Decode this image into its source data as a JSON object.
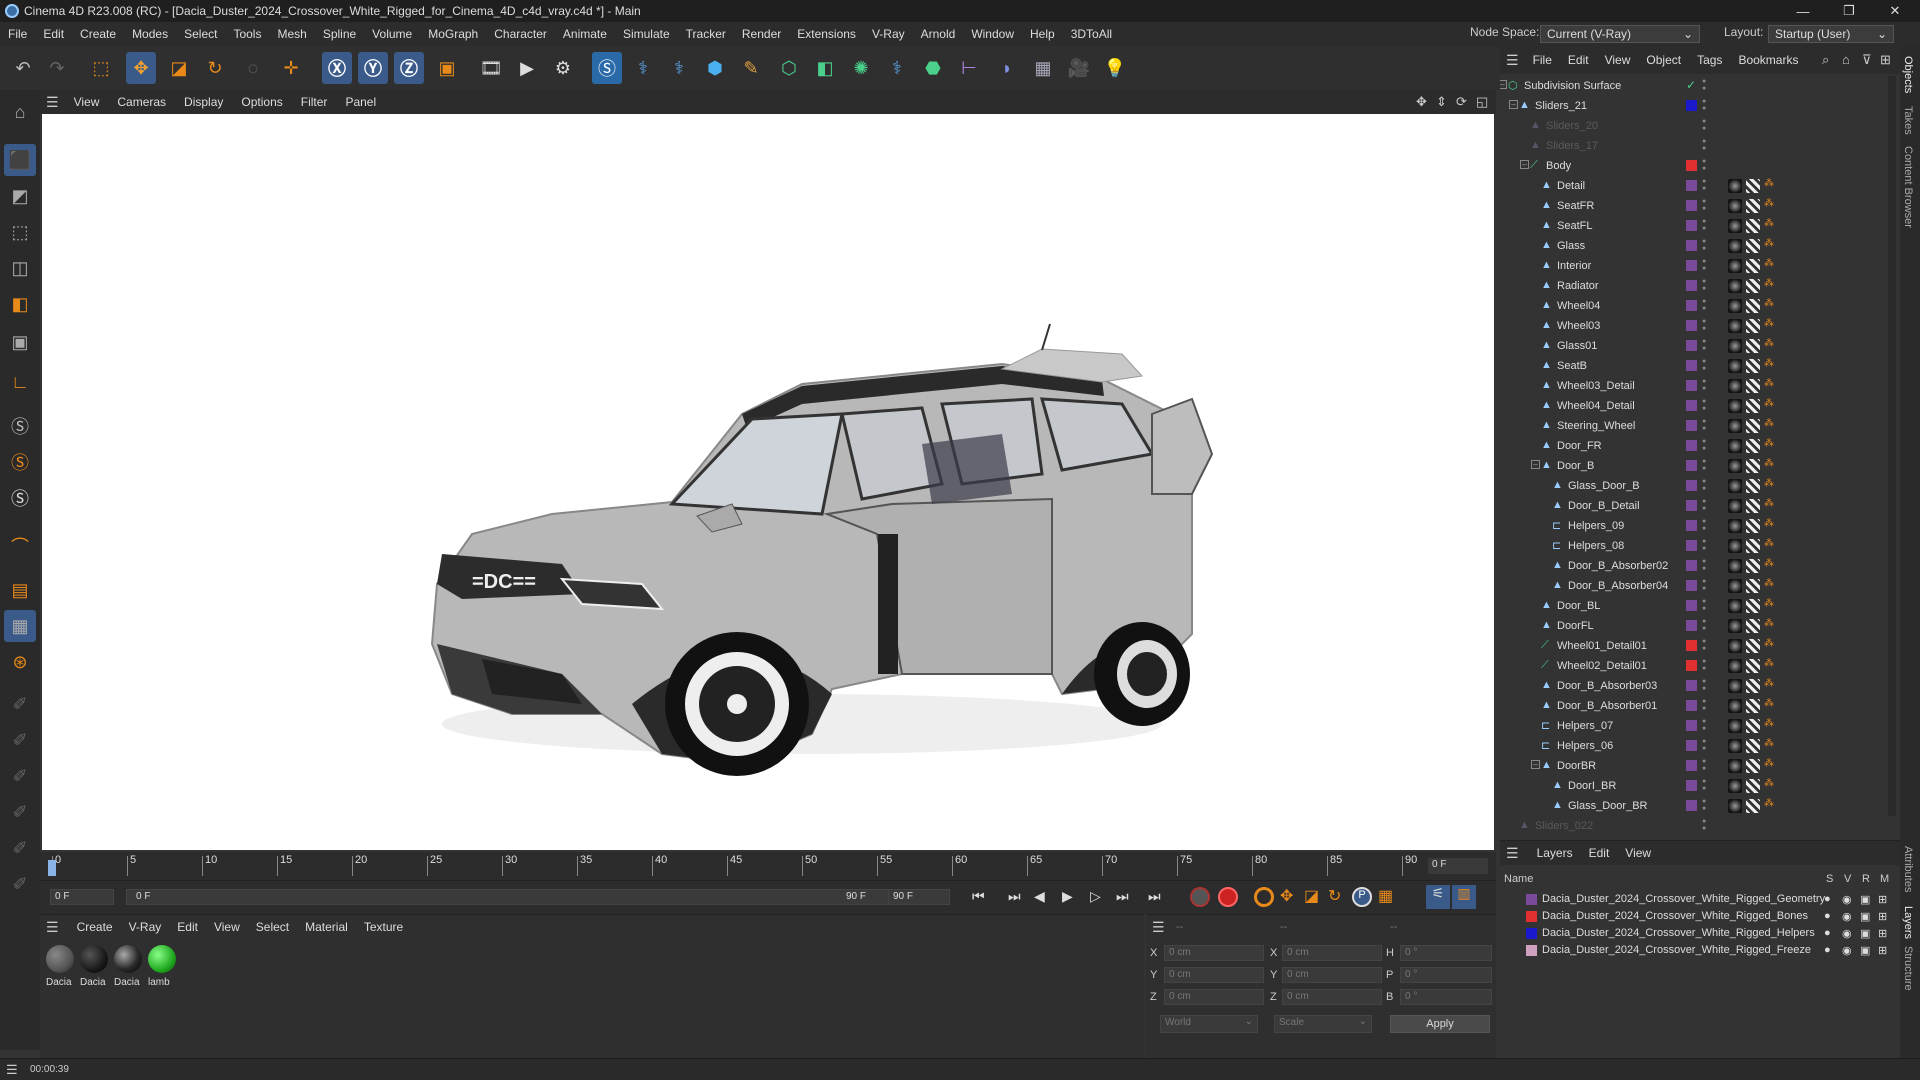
{
  "titlebar": {
    "title": "Cinema 4D R23.008 (RC) - [Dacia_Duster_2024_Crossover_White_Rigged_for_Cinema_4D_c4d_vray.c4d *] - Main",
    "minimize": "—",
    "restore": "❐",
    "close": "✕"
  },
  "menubar": {
    "items": [
      "File",
      "Edit",
      "Create",
      "Modes",
      "Select",
      "Tools",
      "Mesh",
      "Spline",
      "Volume",
      "MoGraph",
      "Character",
      "Animate",
      "Simulate",
      "Tracker",
      "Render",
      "Extensions",
      "V-Ray",
      "Arnold",
      "Window",
      "Help",
      "3DToAll"
    ],
    "node_space_label": "Node Space:",
    "node_space_value": "Current (V-Ray)",
    "layout_label": "Layout:",
    "layout_value": "Startup (User)"
  },
  "viewport_menu": {
    "items": [
      "View",
      "Cameras",
      "Display",
      "Options",
      "Filter",
      "Panel"
    ]
  },
  "object_panel": {
    "menu": [
      "File",
      "Edit",
      "View",
      "Object",
      "Tags",
      "Bookmarks"
    ],
    "rows": [
      {
        "name": "Subdivision Surface",
        "depth": 0,
        "icon": "subdivision-icon",
        "layer": "",
        "dim": false
      },
      {
        "name": "Sliders_21",
        "depth": 1,
        "icon": "null-icon",
        "layer": "#1a1acc",
        "dim": false
      },
      {
        "name": "Sliders_20",
        "depth": 2,
        "icon": "null-icon",
        "layer": "",
        "dim": true
      },
      {
        "name": "Sliders_17",
        "depth": 2,
        "icon": "null-icon",
        "layer": "",
        "dim": true
      },
      {
        "name": "Body",
        "depth": 2,
        "icon": "bone-icon",
        "layer": "#e03030",
        "dim": false
      },
      {
        "name": "Detail",
        "depth": 3,
        "icon": "polygon-icon",
        "layer": "#7a4a9a",
        "dim": false
      },
      {
        "name": "SeatFR",
        "depth": 3,
        "icon": "polygon-icon",
        "layer": "#7a4a9a",
        "dim": false
      },
      {
        "name": "SeatFL",
        "depth": 3,
        "icon": "polygon-icon",
        "layer": "#7a4a9a",
        "dim": false
      },
      {
        "name": "Glass",
        "depth": 3,
        "icon": "polygon-icon",
        "layer": "#7a4a9a",
        "dim": false
      },
      {
        "name": "Interior",
        "depth": 3,
        "icon": "polygon-icon",
        "layer": "#7a4a9a",
        "dim": false
      },
      {
        "name": "Radiator",
        "depth": 3,
        "icon": "polygon-icon",
        "layer": "#7a4a9a",
        "dim": false
      },
      {
        "name": "Wheel04",
        "depth": 3,
        "icon": "polygon-icon",
        "layer": "#7a4a9a",
        "dim": false
      },
      {
        "name": "Wheel03",
        "depth": 3,
        "icon": "polygon-icon",
        "layer": "#7a4a9a",
        "dim": false
      },
      {
        "name": "Glass01",
        "depth": 3,
        "icon": "polygon-icon",
        "layer": "#7a4a9a",
        "dim": false
      },
      {
        "name": "SeatB",
        "depth": 3,
        "icon": "polygon-icon",
        "layer": "#7a4a9a",
        "dim": false
      },
      {
        "name": "Wheel03_Detail",
        "depth": 3,
        "icon": "polygon-icon",
        "layer": "#7a4a9a",
        "dim": false
      },
      {
        "name": "Wheel04_Detail",
        "depth": 3,
        "icon": "polygon-icon",
        "layer": "#7a4a9a",
        "dim": false
      },
      {
        "name": "Steering_Wheel",
        "depth": 3,
        "icon": "polygon-icon",
        "layer": "#7a4a9a",
        "dim": false
      },
      {
        "name": "Door_FR",
        "depth": 3,
        "icon": "polygon-icon",
        "layer": "#7a4a9a",
        "dim": false
      },
      {
        "name": "Door_B",
        "depth": 3,
        "icon": "polygon-icon",
        "layer": "#7a4a9a",
        "dim": false
      },
      {
        "name": "Glass_Door_B",
        "depth": 4,
        "icon": "polygon-icon",
        "layer": "#7a4a9a",
        "dim": false
      },
      {
        "name": "Door_B_Detail",
        "depth": 4,
        "icon": "polygon-icon",
        "layer": "#7a4a9a",
        "dim": false
      },
      {
        "name": "Helpers_09",
        "depth": 4,
        "icon": "helper-icon",
        "layer": "#7a4a9a",
        "dim": false
      },
      {
        "name": "Helpers_08",
        "depth": 4,
        "icon": "helper-icon",
        "layer": "#7a4a9a",
        "dim": false
      },
      {
        "name": "Door_B_Absorber02",
        "depth": 4,
        "icon": "polygon-icon",
        "layer": "#7a4a9a",
        "dim": false
      },
      {
        "name": "Door_B_Absorber04",
        "depth": 4,
        "icon": "polygon-icon",
        "layer": "#7a4a9a",
        "dim": false
      },
      {
        "name": "Door_BL",
        "depth": 3,
        "icon": "polygon-icon",
        "layer": "#7a4a9a",
        "dim": false
      },
      {
        "name": "DoorFL",
        "depth": 3,
        "icon": "polygon-icon",
        "layer": "#7a4a9a",
        "dim": false
      },
      {
        "name": "Wheel01_Detail01",
        "depth": 3,
        "icon": "bone-icon",
        "layer": "#e03030",
        "dim": false
      },
      {
        "name": "Wheel02_Detail01",
        "depth": 3,
        "icon": "bone-icon",
        "layer": "#e03030",
        "dim": false
      },
      {
        "name": "Door_B_Absorber03",
        "depth": 3,
        "icon": "polygon-icon",
        "layer": "#7a4a9a",
        "dim": false
      },
      {
        "name": "Door_B_Absorber01",
        "depth": 3,
        "icon": "polygon-icon",
        "layer": "#7a4a9a",
        "dim": false
      },
      {
        "name": "Helpers_07",
        "depth": 3,
        "icon": "helper-icon",
        "layer": "#7a4a9a",
        "dim": false
      },
      {
        "name": "Helpers_06",
        "depth": 3,
        "icon": "helper-icon",
        "layer": "#7a4a9a",
        "dim": false
      },
      {
        "name": "DoorBR",
        "depth": 3,
        "icon": "polygon-icon",
        "layer": "#7a4a9a",
        "dim": false
      },
      {
        "name": "DoorI_BR",
        "depth": 4,
        "icon": "polygon-icon",
        "layer": "#7a4a9a",
        "dim": false
      },
      {
        "name": "Glass_Door_BR",
        "depth": 4,
        "icon": "polygon-icon",
        "layer": "#7a4a9a",
        "dim": false
      },
      {
        "name": "Sliders_022",
        "depth": 1,
        "icon": "null-icon",
        "layer": "",
        "dim": true
      }
    ]
  },
  "side_tabs": [
    "Objects",
    "Takes",
    "Content Browser",
    "Attributes",
    "Layers",
    "Structure"
  ],
  "timeline": {
    "ticks": [
      "0",
      "5",
      "10",
      "15",
      "20",
      "25",
      "30",
      "35",
      "40",
      "45",
      "50",
      "55",
      "60",
      "65",
      "70",
      "75",
      "80",
      "85",
      "90"
    ],
    "frame_field": "0 F",
    "start_field": "0 F",
    "range_start": "0 F",
    "range_end": "90 F",
    "end_field": "90 F"
  },
  "material_panel": {
    "menu": [
      "Create",
      "V-Ray",
      "Edit",
      "View",
      "Select",
      "Material",
      "Texture"
    ],
    "materials": [
      {
        "label": "Dacia",
        "color": "#555"
      },
      {
        "label": "Dacia",
        "color": "#1a1a1a"
      },
      {
        "label": "Dacia",
        "color": "#2a2a2a"
      },
      {
        "label": "lamb",
        "color": "#22aa22"
      }
    ]
  },
  "coord_panel": {
    "headers": [
      "--",
      "--",
      "--"
    ],
    "rows": [
      {
        "a": "X",
        "av": "0 cm",
        "b": "X",
        "bv": "0 cm",
        "c": "H",
        "cv": "0 °"
      },
      {
        "a": "Y",
        "av": "0 cm",
        "b": "Y",
        "bv": "0 cm",
        "c": "P",
        "cv": "0 °"
      },
      {
        "a": "Z",
        "av": "0 cm",
        "b": "Z",
        "bv": "0 cm",
        "c": "B",
        "cv": "0 °"
      }
    ],
    "world": "World",
    "scale": "Scale",
    "apply": "Apply"
  },
  "layer_panel": {
    "menu": [
      "Layers",
      "Edit",
      "View"
    ],
    "name_header": "Name",
    "cols": [
      "S",
      "V",
      "R",
      "M"
    ],
    "layers": [
      {
        "name": "Dacia_Duster_2024_Crossover_White_Rigged_Geometry",
        "color": "#7a4a9a"
      },
      {
        "name": "Dacia_Duster_2024_Crossover_White_Rigged_Bones",
        "color": "#e03030"
      },
      {
        "name": "Dacia_Duster_2024_Crossover_White_Rigged_Helpers",
        "color": "#1a1acc"
      },
      {
        "name": "Dacia_Duster_2024_Crossover_White_Rigged_Freeze",
        "color": "#d0a0c0"
      }
    ]
  },
  "status": {
    "time": "00:00:39"
  }
}
